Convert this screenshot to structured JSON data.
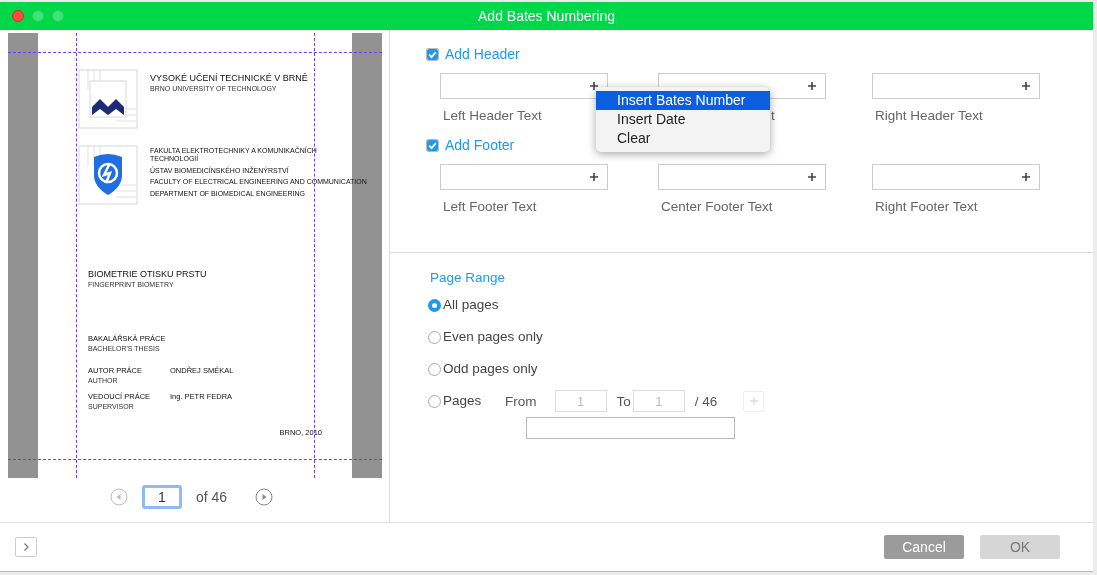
{
  "window": {
    "title": "Add Bates Numbering"
  },
  "preview": {
    "document": {
      "university": {
        "title": "VYSOKÉ UČENÍ TECHNICKÉ V BRNĚ",
        "subtitle": "BRNO UNIVERSITY OF TECHNOLOGY"
      },
      "faculty": [
        "FAKULTA ELEKTROTECHNIKY A KOMUNIKAČNÍCH TECHNOLOGIÍ",
        "ÚSTAV BIOMEDICÍNSKÉHO INŽENÝRSTVÍ",
        "FACULTY OF ELECTRICAL ENGINEERING AND COMMUNICATION",
        "DEPARTMENT OF BIOMEDICAL ENGINEERING"
      ],
      "thesis_title": "BIOMETRIE OTISKU PRSTU",
      "thesis_subtitle": "FINGERPRINT BIOMETRY",
      "thesis_type": "BAKALÁŘSKÁ PRÁCE",
      "thesis_type_en": "BACHELOR'S THESIS",
      "people": [
        {
          "role": "AUTOR PRÁCE",
          "role_en": "AUTHOR",
          "name": "ONDŘEJ SMÉKAL"
        },
        {
          "role": "VEDOUCÍ PRÁCE",
          "role_en": "SUPERVISOR",
          "name": "Ing. PETR FEDRA"
        }
      ],
      "place_date": "BRNO, 2010"
    },
    "page_number": "1",
    "page_count": "of 46"
  },
  "header": {
    "label": "Add Header",
    "checked": true,
    "fields": [
      {
        "label": "Left Header Text",
        "covered": false
      },
      {
        "label": "t",
        "covered": true
      },
      {
        "label": "Right Header Text",
        "covered": false
      }
    ]
  },
  "footer": {
    "label": "Add Footer",
    "checked": true,
    "fields": [
      {
        "label": "Left Footer Text"
      },
      {
        "label": "Center Footer Text"
      },
      {
        "label": "Right Footer Text"
      }
    ]
  },
  "menu": {
    "items": [
      {
        "label": "Insert Bates Number",
        "selected": true
      },
      {
        "label": "Insert Date",
        "selected": false
      },
      {
        "label": "Clear",
        "selected": false
      }
    ]
  },
  "page_range": {
    "title": "Page Range",
    "options": [
      {
        "label": "All pages",
        "selected": true,
        "kind": "plain"
      },
      {
        "label": "Even pages only",
        "selected": false,
        "kind": "plain"
      },
      {
        "label": "Odd pages only",
        "selected": false,
        "kind": "plain"
      },
      {
        "label": "Pages",
        "selected": false,
        "kind": "custom"
      }
    ],
    "from_label": "From",
    "from": "1",
    "to_label": "To",
    "to": "1",
    "total": "/ 46"
  },
  "buttons": [
    {
      "label": "Cancel",
      "disabled": false
    },
    {
      "label": "OK",
      "disabled": true
    }
  ]
}
